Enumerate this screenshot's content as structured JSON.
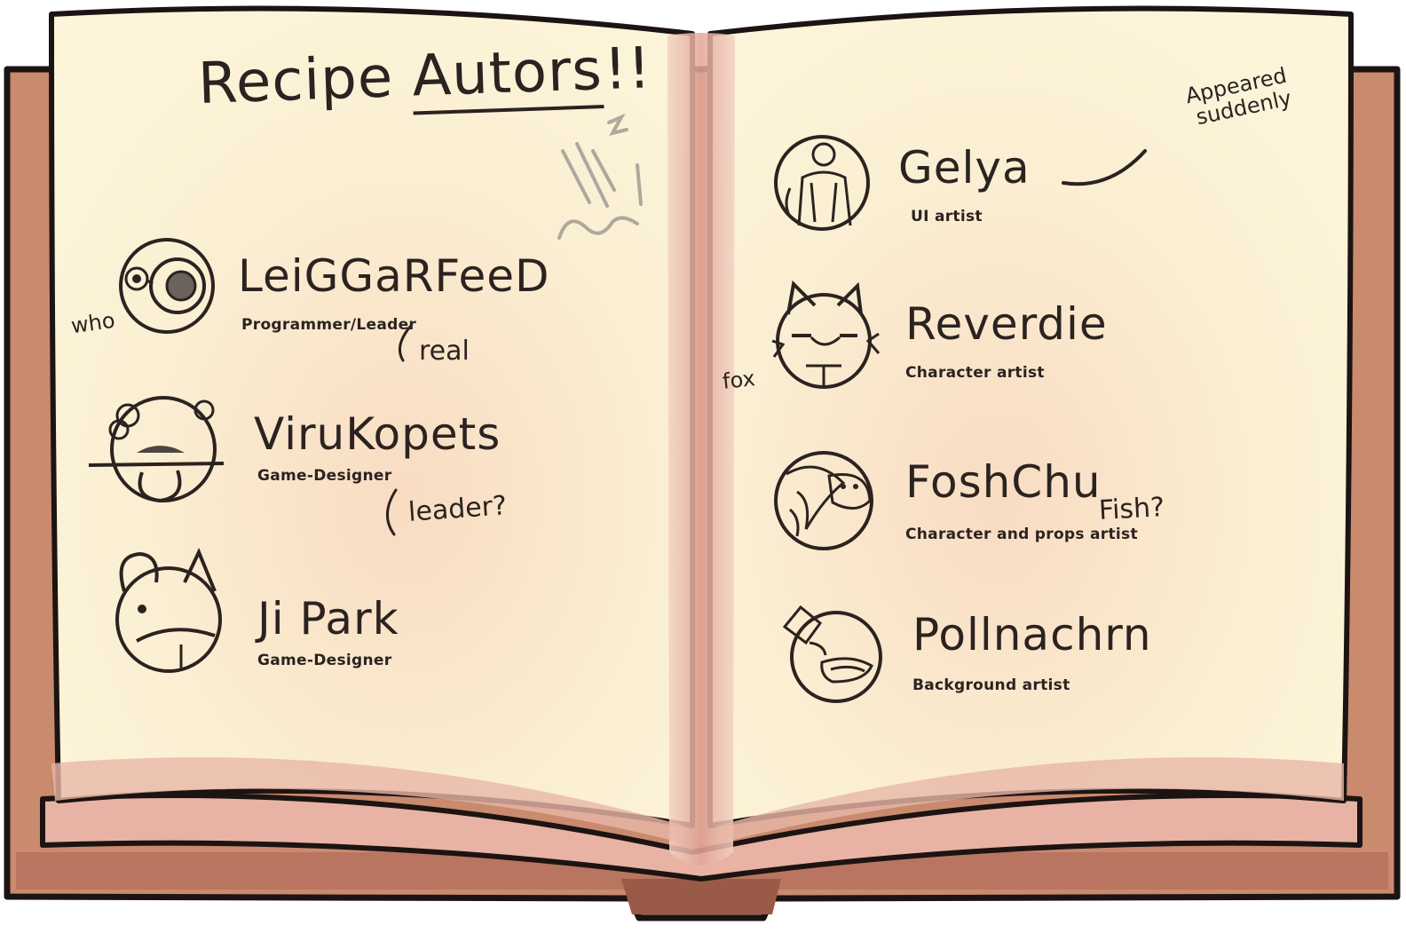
{
  "title": {
    "main": "Recipe",
    "underlined": "Autors",
    "exclaim": "!!"
  },
  "authors_left": [
    {
      "name": "LeiGGaRFeeD",
      "role": "Programmer/Leader",
      "avatar_icon": "eye-avatar-icon",
      "side_note": "who",
      "aside": "real"
    },
    {
      "name": "ViruKopets",
      "role": "Game-Designer",
      "avatar_icon": "axolotl-avatar-icon",
      "aside": "leader?"
    },
    {
      "name": "Ji Park",
      "role": "Game-Designer",
      "avatar_icon": "mouse-avatar-icon"
    }
  ],
  "authors_right": [
    {
      "name": "Gelya",
      "role": "UI artist",
      "avatar_icon": "person-avatar-icon",
      "aside": "Appeared suddenly"
    },
    {
      "name": "Reverdie",
      "role": "Character artist",
      "avatar_icon": "fox-avatar-icon",
      "side_note": "fox"
    },
    {
      "name": "FoshChu",
      "role": "Character and props artist",
      "avatar_icon": "fish-avatar-icon",
      "aside": "Fish?"
    },
    {
      "name": "Pollnachrn",
      "role": "Background artist",
      "avatar_icon": "potion-avatar-icon"
    }
  ],
  "colors": {
    "cover": "#c98a6e",
    "cover_dark": "#9a5a48",
    "page": "#fbf2d6",
    "page_edge": "#e7b3a4",
    "ink": "#2b2320"
  }
}
